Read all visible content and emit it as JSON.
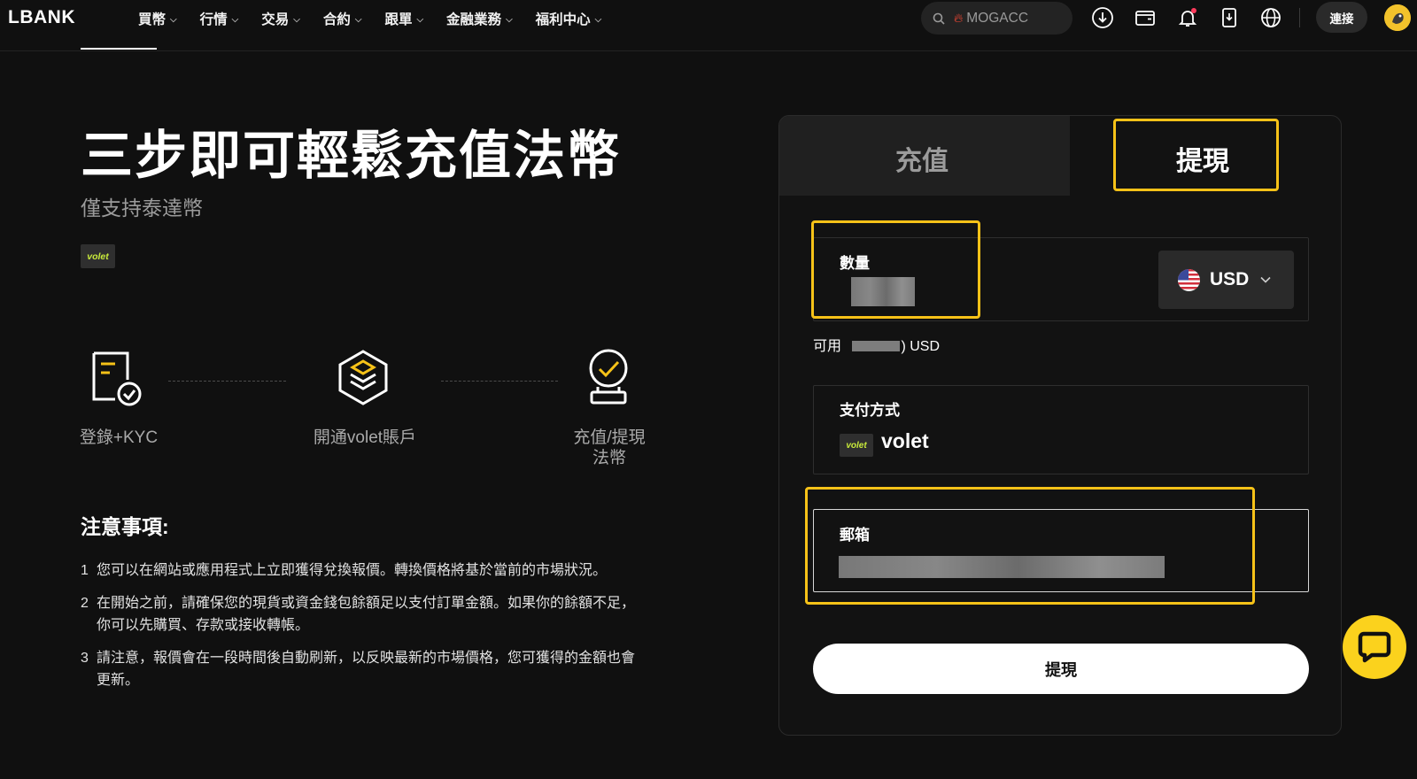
{
  "nav": {
    "logo": "LBANK",
    "menu": [
      {
        "label": "買幣"
      },
      {
        "label": "行情"
      },
      {
        "label": "交易"
      },
      {
        "label": "合約"
      },
      {
        "label": "跟單"
      },
      {
        "label": "金融業務"
      },
      {
        "label": "福利中心"
      }
    ],
    "search_placeholder": "MOGACC",
    "connect_label": "連接"
  },
  "hero": {
    "title": "三步即可輕鬆充值法幣",
    "subtitle": "僅支持泰達幣",
    "badge": "volet"
  },
  "steps": [
    {
      "label": "登錄+KYC",
      "icon": "document-check-icon"
    },
    {
      "label": "開通volet賬戶",
      "icon": "layers-stack-icon"
    },
    {
      "label": "充值/提現\n法幣",
      "icon": "deposit-check-icon"
    }
  ],
  "notes": {
    "title": "注意事項:",
    "items": [
      {
        "num": "1",
        "text": "您可以在網站或應用程式上立即獲得兌換報價。轉換價格將基於當前的市場狀況。"
      },
      {
        "num": "2",
        "text": "在開始之前，請確保您的現貨或資金錢包餘額足以支付訂單金額。如果你的餘額不足，你可以先購買、存款或接收轉帳。"
      },
      {
        "num": "3",
        "text": "請注意，報價會在一段時間後自動刷新，以反映最新的市場價格，您可獲得的金額也會更新。"
      }
    ]
  },
  "card": {
    "tabs": [
      {
        "label": "充值",
        "active": false
      },
      {
        "label": "提現",
        "active": true
      }
    ],
    "amount": {
      "label": "數量"
    },
    "currency": {
      "code": "USD",
      "icon": "us-flag-icon"
    },
    "available": {
      "prefix": "可用",
      "suffix": ") USD"
    },
    "payment": {
      "label": "支付方式",
      "method": "volet",
      "badge": "volet"
    },
    "email": {
      "label": "郵箱"
    },
    "submit_label": "提現"
  },
  "colors": {
    "highlight": "#f6c218",
    "background": "#101010",
    "chat_fab": "#fbd21d",
    "volet_green": "#c8ea3b"
  }
}
